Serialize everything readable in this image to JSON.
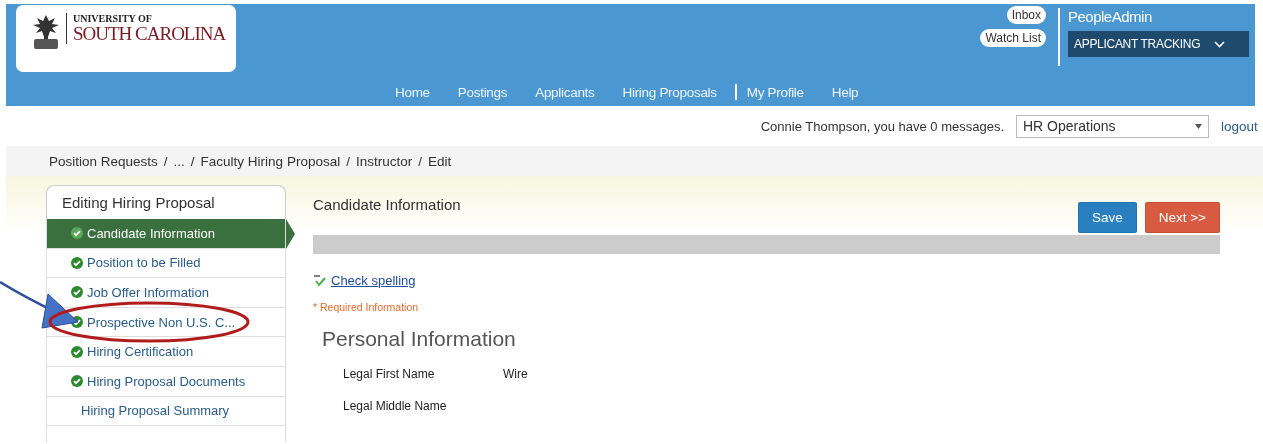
{
  "header": {
    "logo": {
      "line1": "UNIVERSITY OF",
      "line2": "SOUTH CAROLINA"
    },
    "links": [
      "Inbox",
      "Watch List"
    ],
    "product": "PeopleAdmin",
    "module_menu": "APPLICANT TRACKING"
  },
  "nav": [
    {
      "label": "Home",
      "separator_before": false
    },
    {
      "label": "Postings",
      "separator_before": false
    },
    {
      "label": "Applicants",
      "separator_before": false
    },
    {
      "label": "Hiring Proposals",
      "separator_before": false
    },
    {
      "label": "My Profile",
      "separator_before": true
    },
    {
      "label": "Help",
      "separator_before": false
    }
  ],
  "user_bar": {
    "message": "Connie Thompson, you have 0 messages.",
    "role_select": "HR Operations",
    "logout": "logout"
  },
  "breadcrumb": {
    "separator": "/",
    "items": [
      "Position Requests",
      "...",
      "Faculty Hiring Proposal",
      "Instructor",
      "Edit"
    ]
  },
  "sidebar": {
    "title": "Editing Hiring Proposal",
    "items": [
      {
        "label": "Candidate Information",
        "selected": true,
        "complete": true
      },
      {
        "label": "Position to be Filled",
        "selected": false,
        "complete": true
      },
      {
        "label": "Job Offer Information",
        "selected": false,
        "complete": true
      },
      {
        "label": "Prospective Non U.S. C...",
        "selected": false,
        "complete": true
      },
      {
        "label": "Hiring Certification",
        "selected": false,
        "complete": true
      },
      {
        "label": "Hiring Proposal Documents",
        "selected": false,
        "complete": true
      },
      {
        "label": "Hiring Proposal Summary",
        "selected": false,
        "complete": false
      }
    ]
  },
  "main": {
    "title": "Candidate Information",
    "buttons": [
      {
        "label": "Save",
        "kind": "primary"
      },
      {
        "label": "Next >>",
        "kind": "danger"
      }
    ],
    "spell_check": "Check spelling",
    "required_note": "* Required Information",
    "section_title": "Personal Information",
    "fields": [
      {
        "label": "Legal First Name",
        "value": "Wire"
      },
      {
        "label": "Legal Middle Name"
      }
    ]
  }
}
